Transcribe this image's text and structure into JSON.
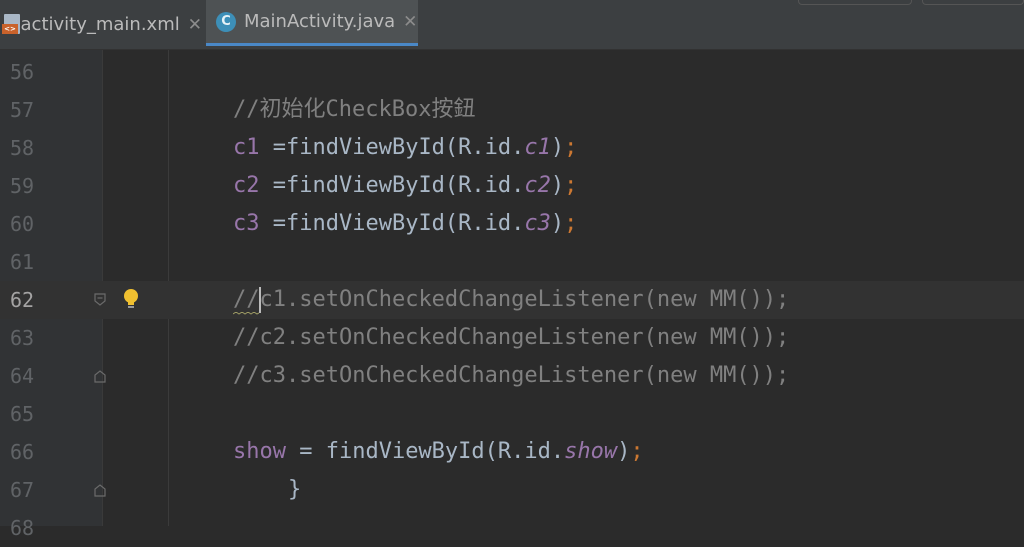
{
  "tabs": [
    {
      "label": "activity_main.xml",
      "icon": "xml-file-icon",
      "active": false
    },
    {
      "label": "MainActivity.java",
      "icon": "java-class-icon",
      "active": true
    }
  ],
  "editor": {
    "lines": [
      {
        "num": "56",
        "text": ""
      },
      {
        "num": "57",
        "text": "//初始化CheckBox按鈕"
      },
      {
        "num": "58",
        "text": "c1 =findViewById(R.id.c1);"
      },
      {
        "num": "59",
        "text": "c2 =findViewById(R.id.c2);"
      },
      {
        "num": "60",
        "text": "c3 =findViewById(R.id.c3);"
      },
      {
        "num": "61",
        "text": ""
      },
      {
        "num": "62",
        "text": "//c1.setOnCheckedChangeListener(new MM());"
      },
      {
        "num": "63",
        "text": "//c2.setOnCheckedChangeListener(new MM());"
      },
      {
        "num": "64",
        "text": "//c3.setOnCheckedChangeListener(new MM());"
      },
      {
        "num": "65",
        "text": ""
      },
      {
        "num": "66",
        "text": "show = findViewById(R.id.show);"
      },
      {
        "num": "67",
        "text": "}"
      },
      {
        "num": "68",
        "text": ""
      }
    ],
    "tokens": {
      "l57_comment": "//初始化CheckBox按鈕",
      "l58_var": "c1",
      "l58_mid": " =findViewById(R.id.",
      "l58_id": "c1",
      "l58_close": ")",
      "l58_semi": ";",
      "l59_var": "c2",
      "l59_mid": " =findViewById(R.id.",
      "l59_id": "c2",
      "l59_close": ")",
      "l59_semi": ";",
      "l60_var": "c3",
      "l60_mid": " =findViewById(R.id.",
      "l60_id": "c3",
      "l60_close": ")",
      "l60_semi": ";",
      "l62_a": "//",
      "l62_b": "c1.setOnCheckedChangeListener(new MM());",
      "l63": "//c2.setOnCheckedChangeListener(new MM());",
      "l64": "//c3.setOnCheckedChangeListener(new MM());",
      "l66_var": "show",
      "l66_mid": " = findViewById(R.id.",
      "l66_id": "show",
      "l66_close": ")",
      "l66_semi": ";",
      "l67": "}"
    },
    "current_line": "62"
  },
  "colors": {
    "background": "#2b2b2b",
    "gutter": "#313335",
    "comment": "#808080",
    "field": "#9876aa",
    "keyword": "#cc7832",
    "text": "#a9b7c6",
    "tab_underline": "#4a88c7",
    "bulb": "#f0c030"
  }
}
